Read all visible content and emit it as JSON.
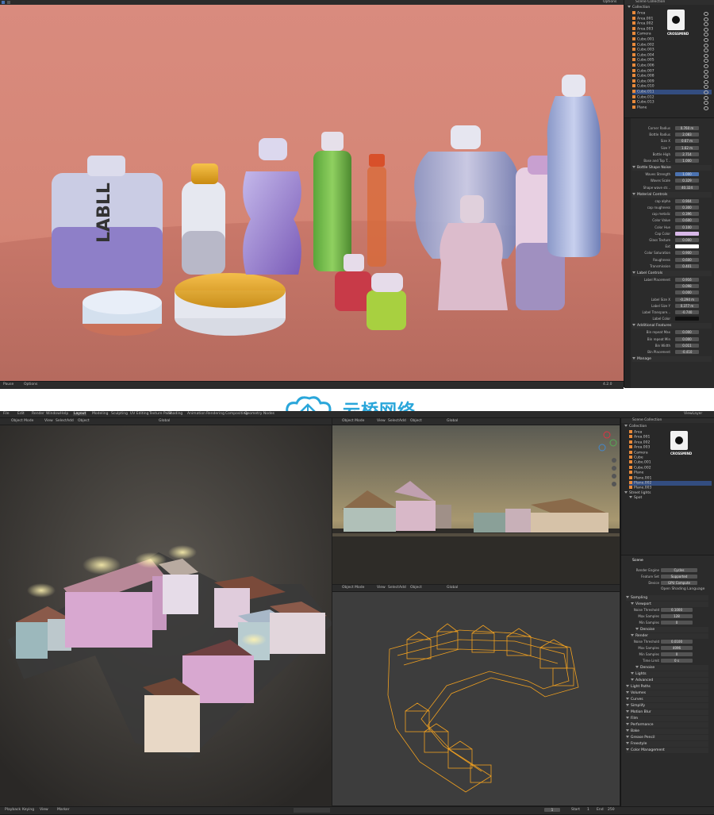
{
  "screenshot1": {
    "header": {
      "options_label": "Options"
    },
    "outliner": {
      "title": "Scene Collection",
      "collection": "Collection",
      "items": [
        "Area",
        "Area.001",
        "Area.002",
        "Area.003",
        "Camera",
        "Cube.001",
        "Cube.002",
        "Cube.003",
        "Cube.004",
        "Cube.005",
        "Cube.006",
        "Cube.007",
        "Cube.008",
        "Cube.009",
        "Cube.010",
        "Cube.011",
        "Cube.012",
        "Cube.013",
        "Plane"
      ],
      "selected_index": 15
    },
    "logo_text": "CROSSMIND",
    "properties": {
      "rows": [
        {
          "label": "Corner Radius",
          "value": "0.760 m"
        },
        {
          "label": "Bottle Radius",
          "value": "2.083"
        },
        {
          "label": "Size X",
          "value": "0.67 m"
        },
        {
          "label": "Size Y",
          "value": "1.62 m"
        },
        {
          "label": "Bottle High",
          "value": "2.714"
        },
        {
          "label": "Base and Top T...",
          "value": "1.000"
        }
      ],
      "section_shape": "Bottle Shape Noise",
      "noise_rows": [
        {
          "label": "Waves Strength",
          "value": "1.000",
          "blue": true
        },
        {
          "label": "Waves Scale",
          "value": "0.329"
        },
        {
          "label": "Shape wave str...",
          "value": "40.324"
        }
      ],
      "section_material": "Material Controls",
      "material_rows": [
        {
          "label": "cap alpha",
          "value": "0.904"
        },
        {
          "label": "cap roughness",
          "value": "0.300"
        },
        {
          "label": "cap metalic",
          "value": "0.396"
        },
        {
          "label": "Color Value",
          "value": "0.600"
        },
        {
          "label": "Color Hue",
          "value": "0.100"
        },
        {
          "label": "Cap Color",
          "value": "",
          "swatch": "#d8b8e8"
        },
        {
          "label": "Glass Texture",
          "value": "0.000"
        },
        {
          "label": "Ext",
          "value": "",
          "swatch": "#ffffff"
        },
        {
          "label": "Color Saturation",
          "value": "0.900"
        },
        {
          "label": "Roughness",
          "value": "0.600"
        },
        {
          "label": "Transmission",
          "value": "0.401"
        }
      ],
      "section_label": "Label Controls",
      "label_rows": [
        {
          "label": "Label Placement",
          "value": "0.916"
        },
        {
          "label": "",
          "value": "0.098"
        },
        {
          "label": "",
          "value": "0.000"
        },
        {
          "label": "Label Size X",
          "value": "-0.294 m"
        },
        {
          "label": "Label Size Y",
          "value": "0.377 m"
        },
        {
          "label": "Label Transpare...",
          "value": "-0.740"
        },
        {
          "label": "Label Color",
          "value": "",
          "swatch": "#111111"
        }
      ],
      "section_additional": "Additional Features",
      "additional_rows": [
        {
          "label": "Bin repeat Max",
          "value": "0.000"
        },
        {
          "label": "Bin repeat Min",
          "value": "0.000"
        },
        {
          "label": "Bin Width",
          "value": "0.011"
        },
        {
          "label": "Bin Placement",
          "value": "-0.410"
        }
      ],
      "section_manage": "Manage"
    },
    "status": {
      "left": "Pause",
      "middle": "Options",
      "version": "4.2.0"
    },
    "label_word": "LABLL"
  },
  "screenshot2": {
    "menu": [
      "File",
      "Edit",
      "Render",
      "Window",
      "Help"
    ],
    "workspaces": [
      "Layout",
      "Modeling",
      "Sculpting",
      "UV Editing",
      "Texture Paint",
      "Shading",
      "Animation",
      "Rendering",
      "Compositing",
      "Geometry Nodes"
    ],
    "mode_left": "Object Mode",
    "view_menu": [
      "View",
      "Select",
      "Add",
      "Object"
    ],
    "orientation": "Global",
    "options_label": "Options",
    "viewlayer": "ViewLayer",
    "outliner": {
      "title": "Scene Collection",
      "collection": "Collection",
      "items": [
        "Area",
        "Area.001",
        "Area.002",
        "Area.003",
        "Camera",
        "Cube",
        "Cube.001",
        "Cube.002",
        "Plane",
        "Plane.001",
        "Plane.002",
        "Plane.003"
      ],
      "selected_index": 10,
      "extra": [
        "Street lights",
        "Spot"
      ]
    },
    "logo_text": "CROSSMIND",
    "properties": {
      "scene_label": "Scene",
      "render_engine_label": "Render Engine",
      "render_engine": "Cycles",
      "feature_set_label": "Feature Set",
      "feature_set": "Supported",
      "device_label": "Device",
      "device": "GPU Compute",
      "osl": "Open Shading Language",
      "sampling": "Sampling",
      "viewport": "Viewport",
      "vp_noise": {
        "label": "Noise Threshold",
        "value": "0.1000"
      },
      "vp_max": {
        "label": "Max Samples",
        "value": "128"
      },
      "vp_min": {
        "label": "Min Samples",
        "value": "0"
      },
      "denoise1": "Denoise",
      "render": "Render",
      "r_noise": {
        "label": "Noise Threshold",
        "value": "0.0100"
      },
      "r_max": {
        "label": "Max Samples",
        "value": "4096"
      },
      "r_min": {
        "label": "Min Samples",
        "value": "0"
      },
      "r_time": {
        "label": "Time Limit",
        "value": "0 s"
      },
      "denoise2": "Denoise",
      "lights": "Lights",
      "advanced": "Advanced",
      "panels": [
        "Light Paths",
        "Volumes",
        "Curves",
        "Simplify",
        "Motion Blur",
        "Film",
        "Performance",
        "Bake",
        "Grease Pencil",
        "Freestyle",
        "Color Management"
      ]
    },
    "timeline": [
      "Playback",
      "Keying",
      "View",
      "Marker"
    ],
    "frame": {
      "current": "1",
      "start_label": "Start",
      "start": "1",
      "end_label": "End",
      "end": "250"
    }
  },
  "watermark": "云桥网络",
  "colors": {
    "accent": "#4b72b0",
    "object": "#e8893a",
    "wire": "#f0a020",
    "bg": "#1d1d1d",
    "panel": "#2b2b2b",
    "watermark": "#2aa6da"
  }
}
